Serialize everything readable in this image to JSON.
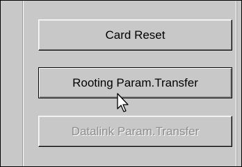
{
  "buttons": {
    "card_reset": "Card Reset",
    "rooting_param_transfer": "Rooting Param.Transfer",
    "datalink_param_transfer": "Datalink Param.Transfer"
  },
  "states": {
    "datalink_param_transfer_enabled": false
  },
  "icons": {
    "cursor": "mouse-pointer-arrow"
  }
}
